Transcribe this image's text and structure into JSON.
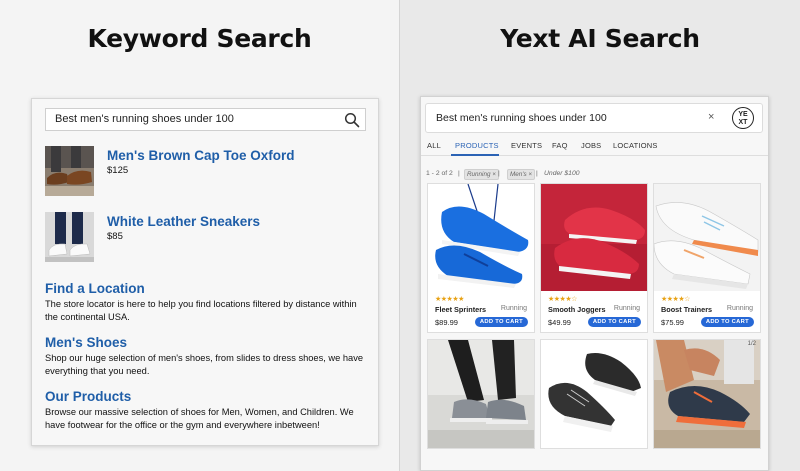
{
  "keyword": {
    "heading": "Keyword Search",
    "query": "Best men's running shoes under 100",
    "products": [
      {
        "name": "Men's Brown Cap Toe Oxford",
        "price": "$125"
      },
      {
        "name": "White Leather Sneakers",
        "price": "$85"
      }
    ],
    "sections": [
      {
        "title": "Find a Location",
        "body": "The store locator is here to help you find locations filtered by distance within the continental USA."
      },
      {
        "title": "Men's Shoes",
        "body": "Shop our huge selection of men's shoes, from slides to dress shoes, we have everything that you need."
      },
      {
        "title": "Our Products",
        "body": "Browse our massive selection of shoes for Men, Women, and Children. We have footwear for the office or the gym and everywhere inbetween!"
      }
    ]
  },
  "ai": {
    "heading": "Yext AI Search",
    "query": "Best men's running shoes under 100",
    "clear": "×",
    "logo_text": "YE XT",
    "tabs": [
      "ALL",
      "PRODUCTS",
      "EVENTS",
      "FAQ",
      "JOBS",
      "LOCATIONS"
    ],
    "active_tab": "PRODUCTS",
    "results_count": "1 - 2 of 2",
    "filters": [
      "Running ×",
      "Men's ×",
      "Under $100"
    ],
    "cards": [
      {
        "name": "Fleet Sprinters",
        "tag": "Running",
        "price": "$89.99",
        "button": "ADD TO CART",
        "stars": "★★★★★",
        "rating": 5
      },
      {
        "name": "Smooth Joggers",
        "tag": "Running",
        "price": "$49.99",
        "button": "ADD TO CART",
        "stars": "★★★★☆",
        "rating": 4
      },
      {
        "name": "Boost Trainers",
        "tag": "Running",
        "price": "$75.99",
        "button": "ADD TO CART",
        "stars": "★★★★☆",
        "rating": 4
      }
    ],
    "corner_badge": "1/2",
    "colors": {
      "accent": "#2668d6",
      "link": "#1f5ea8",
      "star": "#e8a215"
    }
  }
}
